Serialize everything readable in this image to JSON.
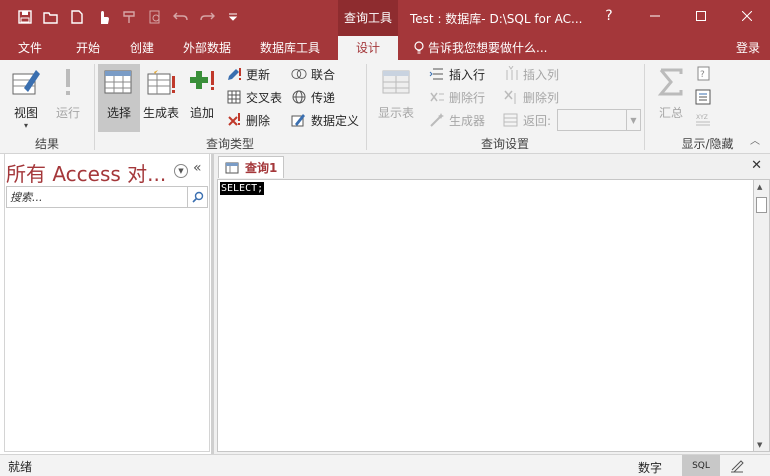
{
  "titlebar": {
    "context_tool": "查询工具",
    "doc_title": "Test : 数据库- D:\\SQL for AC...",
    "help": "?"
  },
  "tabs": [
    {
      "label": "文件"
    },
    {
      "label": "开始"
    },
    {
      "label": "创建"
    },
    {
      "label": "外部数据"
    },
    {
      "label": "数据库工具"
    },
    {
      "label": "设计"
    }
  ],
  "tell_me": "告诉我您想要做什么...",
  "login": "登录",
  "ribbon": {
    "results": {
      "label": "结果",
      "view": "视图",
      "run": "运行"
    },
    "query_type": {
      "label": "查询类型",
      "select": "选择",
      "make_table": "生成表",
      "append": "追加",
      "update": "更新",
      "crosstab": "交叉表",
      "delete": "删除",
      "union": "联合",
      "pass_through": "传递",
      "data_definition": "数据定义"
    },
    "query_setup": {
      "label": "查询设置",
      "show_table": "显示表",
      "insert_rows": "插入行",
      "delete_rows": "删除行",
      "builder": "生成器",
      "insert_columns": "插入列",
      "delete_columns": "删除列",
      "return": "返回:",
      "return_value": ""
    },
    "show_hide": {
      "label": "显示/隐藏",
      "totals": "汇总"
    }
  },
  "nav": {
    "title": "所有 Access 对...",
    "search_placeholder": "搜索..."
  },
  "document": {
    "tab_label": "查询1",
    "sql": "SELECT;"
  },
  "status": {
    "ready": "就绪",
    "numlock": "数字",
    "sql_view": "SQL"
  },
  "colors": {
    "accent": "#a4373a",
    "ribbon_bg": "#f3f3f3"
  }
}
